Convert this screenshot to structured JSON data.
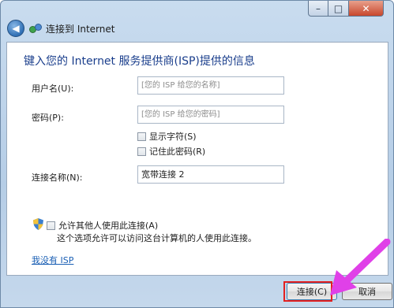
{
  "window": {
    "nav_title": "连接到 Internet",
    "caption": {
      "close_glyph": "✕",
      "min_glyph": "–",
      "max_glyph": "□"
    }
  },
  "form": {
    "heading": "键入您的 Internet 服务提供商(ISP)提供的信息",
    "username": {
      "label": "用户名(U):",
      "placeholder": "[您的 ISP 给您的名称]"
    },
    "password": {
      "label": "密码(P):",
      "placeholder": "[您的 ISP 给您的密码]"
    },
    "show_chars": {
      "label": "显示字符(S)",
      "checked": false
    },
    "remember_password": {
      "label": "记住此密码(R)",
      "checked": false
    },
    "connection_name": {
      "label": "连接名称(N):",
      "value": "宽带连接 2"
    },
    "allow_others": {
      "label": "允许其他人使用此连接(A)",
      "checked": false
    },
    "allow_others_note": "这个选项允许可以访问这台计算机的人使用此连接。",
    "no_isp_link": "我没有 ISP"
  },
  "buttons": {
    "connect": "连接(C)",
    "cancel": "取消"
  },
  "colors": {
    "highlight": "#e32020",
    "arrow": "#e040e8",
    "link": "#1a5fb4",
    "heading": "#1a3e8c"
  }
}
